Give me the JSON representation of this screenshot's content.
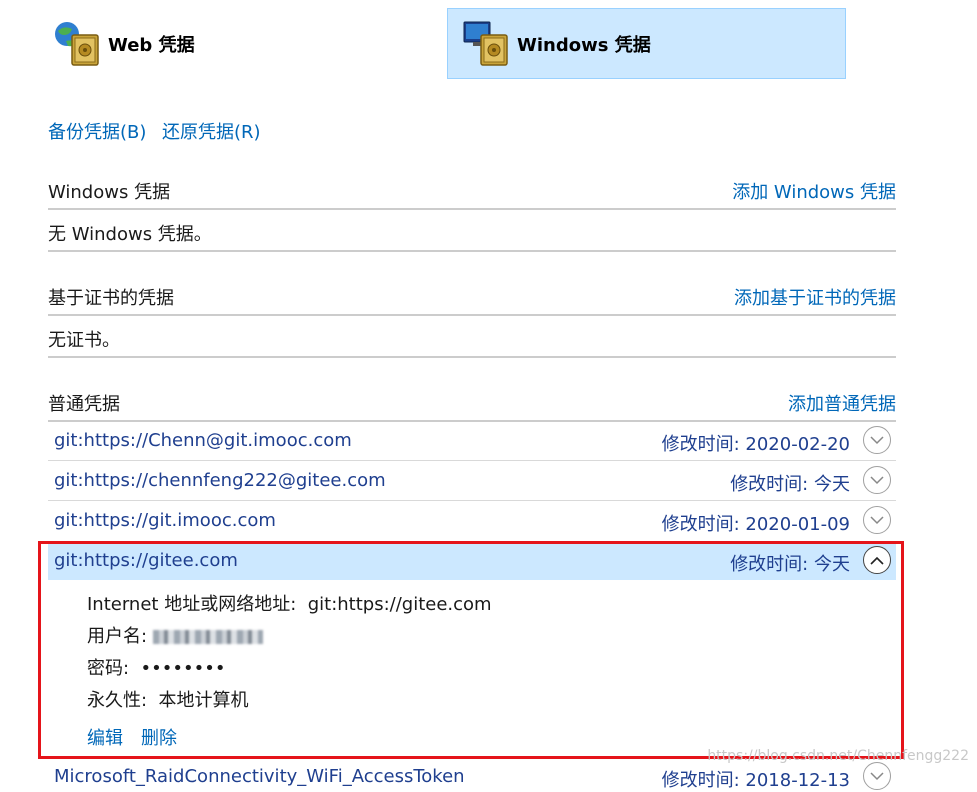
{
  "tabs": {
    "web_label": "Web 凭据",
    "windows_label": "Windows 凭据"
  },
  "actions": {
    "backup": "备份凭据(B)",
    "restore": "还原凭据(R)"
  },
  "windows_section": {
    "title": "Windows 凭据",
    "add_link": "添加 Windows 凭据",
    "empty_text": "无 Windows 凭据。"
  },
  "cert_section": {
    "title": "基于证书的凭据",
    "add_link": "添加基于证书的凭据",
    "empty_text": "无证书。"
  },
  "generic_section": {
    "title": "普通凭据",
    "add_link": "添加普通凭据",
    "items": [
      {
        "name": "git:https://Chenn@git.imooc.com",
        "date_label": "修改时间:",
        "date": "2020-02-20"
      },
      {
        "name": "git:https://chennfeng222@gitee.com",
        "date_label": "修改时间:",
        "date": "今天"
      },
      {
        "name": "git:https://git.imooc.com",
        "date_label": "修改时间:",
        "date": "2020-01-09"
      },
      {
        "name": "git:https://gitee.com",
        "date_label": "修改时间:",
        "date": "今天"
      },
      {
        "name": "Microsoft_RaidConnectivity_WiFi_AccessToken",
        "date_label": "修改时间:",
        "date": "2018-12-13"
      }
    ],
    "expanded": {
      "address_label": "Internet 地址或网络地址:",
      "address_value": "git:https://gitee.com",
      "username_label": "用户名:",
      "password_label": "密码:",
      "password_value": "••••••••",
      "persistence_label": "永久性:",
      "persistence_value": "本地计算机",
      "edit": "编辑",
      "delete": "删除"
    }
  },
  "watermark": "https://blog.csdn.net/Chennfengg222",
  "colors": {
    "link": "#0067b8",
    "selected_tab_bg": "#cce8ff",
    "highlight_border": "#e5141a"
  }
}
